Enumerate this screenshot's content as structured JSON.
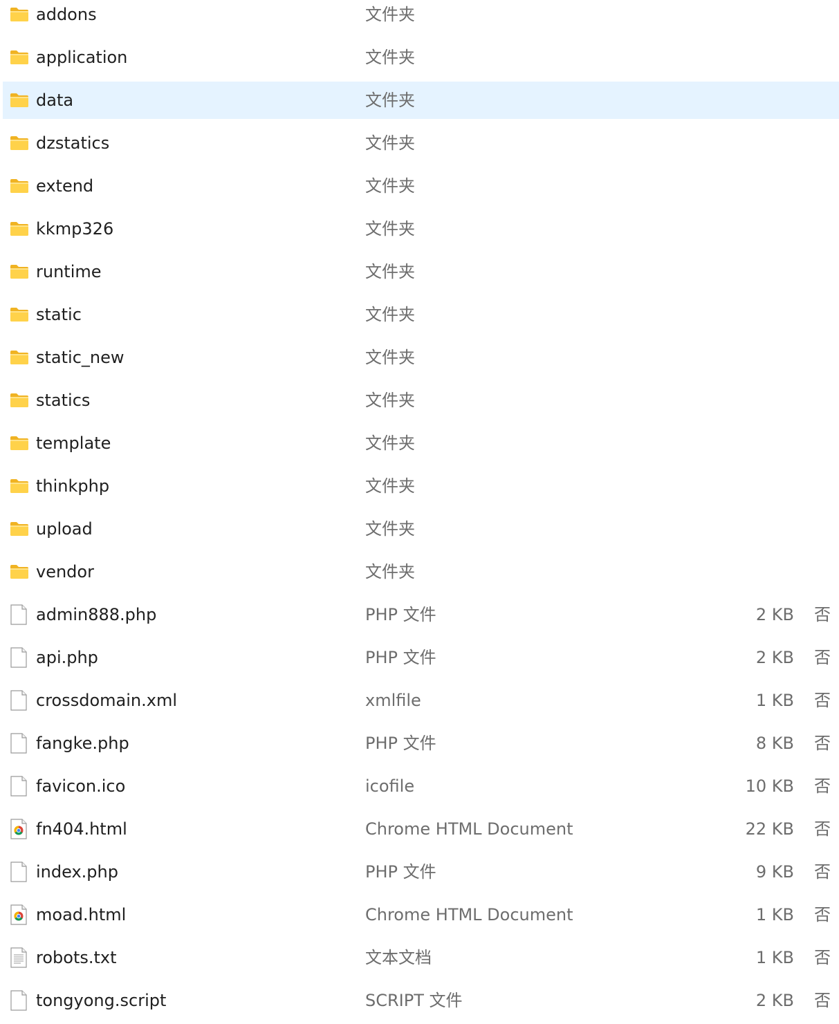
{
  "window": {
    "selected_index": 2
  },
  "files": [
    {
      "name": "addons",
      "type": "文件夹",
      "size": "",
      "flag": "",
      "icon": "folder-icon"
    },
    {
      "name": "application",
      "type": "文件夹",
      "size": "",
      "flag": "",
      "icon": "folder-icon"
    },
    {
      "name": "data",
      "type": "文件夹",
      "size": "",
      "flag": "",
      "icon": "folder-icon"
    },
    {
      "name": "dzstatics",
      "type": "文件夹",
      "size": "",
      "flag": "",
      "icon": "folder-icon"
    },
    {
      "name": "extend",
      "type": "文件夹",
      "size": "",
      "flag": "",
      "icon": "folder-icon"
    },
    {
      "name": "kkmp326",
      "type": "文件夹",
      "size": "",
      "flag": "",
      "icon": "folder-icon"
    },
    {
      "name": "runtime",
      "type": "文件夹",
      "size": "",
      "flag": "",
      "icon": "folder-icon"
    },
    {
      "name": "static",
      "type": "文件夹",
      "size": "",
      "flag": "",
      "icon": "folder-icon"
    },
    {
      "name": "static_new",
      "type": "文件夹",
      "size": "",
      "flag": "",
      "icon": "folder-icon"
    },
    {
      "name": "statics",
      "type": "文件夹",
      "size": "",
      "flag": "",
      "icon": "folder-icon"
    },
    {
      "name": "template",
      "type": "文件夹",
      "size": "",
      "flag": "",
      "icon": "folder-icon"
    },
    {
      "name": "thinkphp",
      "type": "文件夹",
      "size": "",
      "flag": "",
      "icon": "folder-icon"
    },
    {
      "name": "upload",
      "type": "文件夹",
      "size": "",
      "flag": "",
      "icon": "folder-icon"
    },
    {
      "name": "vendor",
      "type": "文件夹",
      "size": "",
      "flag": "",
      "icon": "folder-icon"
    },
    {
      "name": "admin888.php",
      "type": "PHP 文件",
      "size": "2 KB",
      "flag": "否",
      "icon": "file-icon"
    },
    {
      "name": "api.php",
      "type": "PHP 文件",
      "size": "2 KB",
      "flag": "否",
      "icon": "file-icon"
    },
    {
      "name": "crossdomain.xml",
      "type": "xmlfile",
      "size": "1 KB",
      "flag": "否",
      "icon": "file-icon"
    },
    {
      "name": "fangke.php",
      "type": "PHP 文件",
      "size": "8 KB",
      "flag": "否",
      "icon": "file-icon"
    },
    {
      "name": "favicon.ico",
      "type": "icofile",
      "size": "10 KB",
      "flag": "否",
      "icon": "file-icon"
    },
    {
      "name": "fn404.html",
      "type": "Chrome HTML Document",
      "size": "22 KB",
      "flag": "否",
      "icon": "chrome-html-icon"
    },
    {
      "name": "index.php",
      "type": "PHP 文件",
      "size": "9 KB",
      "flag": "否",
      "icon": "file-icon"
    },
    {
      "name": "moad.html",
      "type": "Chrome HTML Document",
      "size": "1 KB",
      "flag": "否",
      "icon": "chrome-html-icon"
    },
    {
      "name": "robots.txt",
      "type": "文本文档",
      "size": "1 KB",
      "flag": "否",
      "icon": "text-file-icon"
    },
    {
      "name": "tongyong.script",
      "type": "SCRIPT 文件",
      "size": "2 KB",
      "flag": "否",
      "icon": "file-icon"
    }
  ],
  "colors": {
    "selection": "#e5f3ff",
    "name_text": "#1f1f1f",
    "meta_text": "#6d6d6d",
    "folder_body": "#ffd24a",
    "folder_tab": "#f0b323"
  }
}
